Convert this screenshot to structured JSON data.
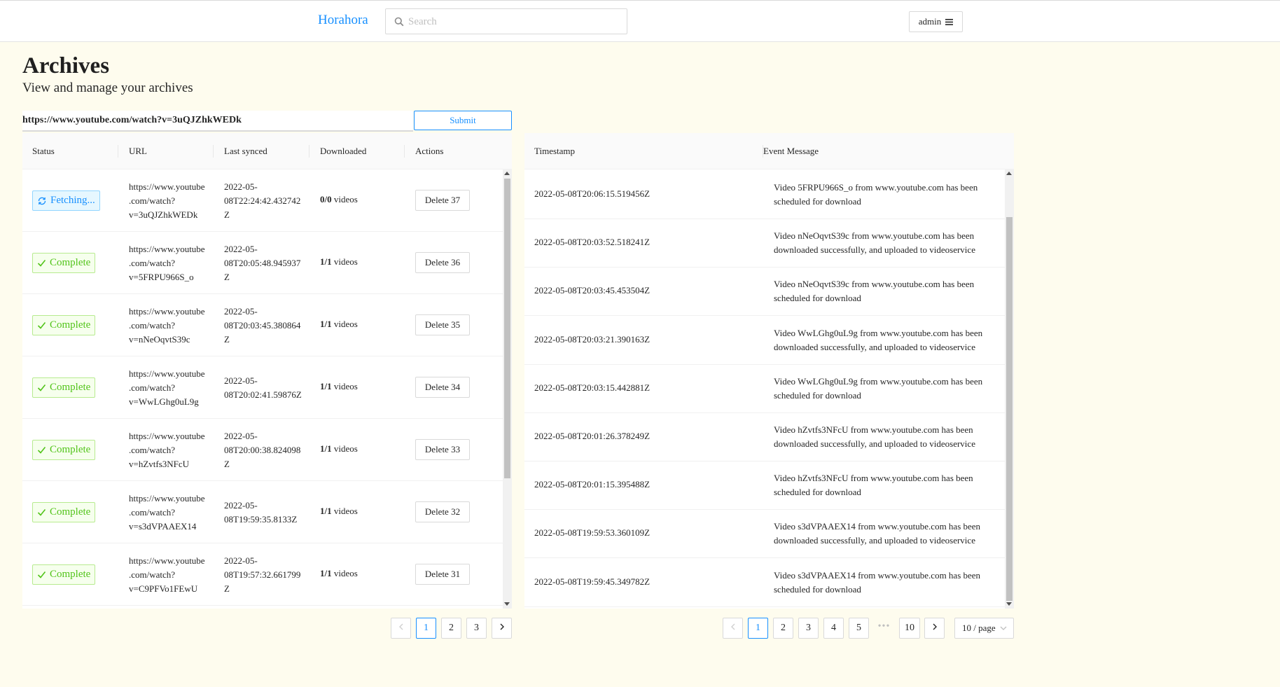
{
  "app": {
    "brand": "Horahora"
  },
  "search": {
    "placeholder": "Search"
  },
  "user_menu": {
    "label": "admin"
  },
  "page": {
    "title": "Archives",
    "subtitle": "View and manage your archives"
  },
  "url_form": {
    "value": "https://www.youtube.com/watch?v=3uQJZhkWEDk",
    "submit_label": "Submit"
  },
  "archives": {
    "columns": [
      "Status",
      "URL",
      "Last synced",
      "Downloaded",
      "Actions"
    ],
    "rows": [
      {
        "status": "Fetching...",
        "url_lines": [
          "https://www.youtube",
          ".com/watch?",
          "v=3uQJZhkWEDk"
        ],
        "synced_lines": [
          "2022-05-",
          "08T22:24:42.432742",
          "Z"
        ],
        "downloaded_count": "0/0",
        "downloaded_unit": "videos",
        "action": "Delete 37"
      },
      {
        "status": "Complete",
        "url_lines": [
          "https://www.youtube",
          ".com/watch?",
          "v=5FRPU966S_o"
        ],
        "synced_lines": [
          "2022-05-",
          "08T20:05:48.945937",
          "Z"
        ],
        "downloaded_count": "1/1",
        "downloaded_unit": "videos",
        "action": "Delete 36"
      },
      {
        "status": "Complete",
        "url_lines": [
          "https://www.youtube",
          ".com/watch?",
          "v=nNeOqvtS39c"
        ],
        "synced_lines": [
          "2022-05-",
          "08T20:03:45.380864",
          "Z"
        ],
        "downloaded_count": "1/1",
        "downloaded_unit": "videos",
        "action": "Delete 35"
      },
      {
        "status": "Complete",
        "url_lines": [
          "https://www.youtube",
          ".com/watch?",
          "v=WwLGhg0uL9g"
        ],
        "synced_lines": [
          "2022-05-",
          "08T20:02:41.59876Z"
        ],
        "downloaded_count": "1/1",
        "downloaded_unit": "videos",
        "action": "Delete 34"
      },
      {
        "status": "Complete",
        "url_lines": [
          "https://www.youtube",
          ".com/watch?",
          "v=hZvtfs3NFcU"
        ],
        "synced_lines": [
          "2022-05-",
          "08T20:00:38.824098",
          "Z"
        ],
        "downloaded_count": "1/1",
        "downloaded_unit": "videos",
        "action": "Delete 33"
      },
      {
        "status": "Complete",
        "url_lines": [
          "https://www.youtube",
          ".com/watch?",
          "v=s3dVPAAEX14"
        ],
        "synced_lines": [
          "2022-05-",
          "08T19:59:35.8133Z"
        ],
        "downloaded_count": "1/1",
        "downloaded_unit": "videos",
        "action": "Delete 32"
      },
      {
        "status": "Complete",
        "url_lines": [
          "https://www.youtube",
          ".com/watch?",
          "v=C9PFVo1FEwU"
        ],
        "synced_lines": [
          "2022-05-",
          "08T19:57:32.661799",
          "Z"
        ],
        "downloaded_count": "1/1",
        "downloaded_unit": "videos",
        "action": "Delete 31"
      }
    ],
    "pagination": {
      "pages": [
        "1",
        "2",
        "3"
      ],
      "current": "1"
    }
  },
  "events": {
    "columns": [
      "Timestamp",
      "Event Message"
    ],
    "rows": [
      {
        "timestamp": "2022-05-08T20:06:15.519456Z",
        "message_lines": [
          "Video 5FRPU966S_o from www.youtube.com has been",
          "scheduled for download"
        ]
      },
      {
        "timestamp": "2022-05-08T20:03:52.518241Z",
        "message_lines": [
          "Video nNeOqvtS39c from www.youtube.com has been",
          "downloaded successfully, and uploaded to videoservice"
        ]
      },
      {
        "timestamp": "2022-05-08T20:03:45.453504Z",
        "message_lines": [
          "Video nNeOqvtS39c from www.youtube.com has been",
          "scheduled for download"
        ]
      },
      {
        "timestamp": "2022-05-08T20:03:21.390163Z",
        "message_lines": [
          "Video WwLGhg0uL9g from www.youtube.com has been",
          "downloaded successfully, and uploaded to videoservice"
        ]
      },
      {
        "timestamp": "2022-05-08T20:03:15.442881Z",
        "message_lines": [
          "Video WwLGhg0uL9g from www.youtube.com has been",
          "scheduled for download"
        ]
      },
      {
        "timestamp": "2022-05-08T20:01:26.378249Z",
        "message_lines": [
          "Video hZvtfs3NFcU from www.youtube.com has been",
          "downloaded successfully, and uploaded to videoservice"
        ]
      },
      {
        "timestamp": "2022-05-08T20:01:15.395488Z",
        "message_lines": [
          "Video hZvtfs3NFcU from www.youtube.com has been",
          "scheduled for download"
        ]
      },
      {
        "timestamp": "2022-05-08T19:59:53.360109Z",
        "message_lines": [
          "Video s3dVPAAEX14 from www.youtube.com has been",
          "downloaded successfully, and uploaded to videoservice"
        ]
      },
      {
        "timestamp": "2022-05-08T19:59:45.349782Z",
        "message_lines": [
          "Video s3dVPAAEX14 from www.youtube.com has been",
          "scheduled for download"
        ]
      }
    ],
    "pagination": {
      "pages": [
        "1",
        "2",
        "3",
        "4",
        "5",
        "10"
      ],
      "ellipsis": "•••",
      "current": "1",
      "page_size": "10 / page"
    }
  },
  "colors": {
    "background": "#fefcee",
    "accent": "#1890ff",
    "success": "#52c41a"
  },
  "icons": {
    "search": "search-icon",
    "menu": "menu-icon",
    "sync": "sync-icon",
    "check": "check-icon",
    "chevron_left": "chevron-left-icon",
    "chevron_right": "chevron-right-icon",
    "chevron_down": "chevron-down-icon"
  }
}
